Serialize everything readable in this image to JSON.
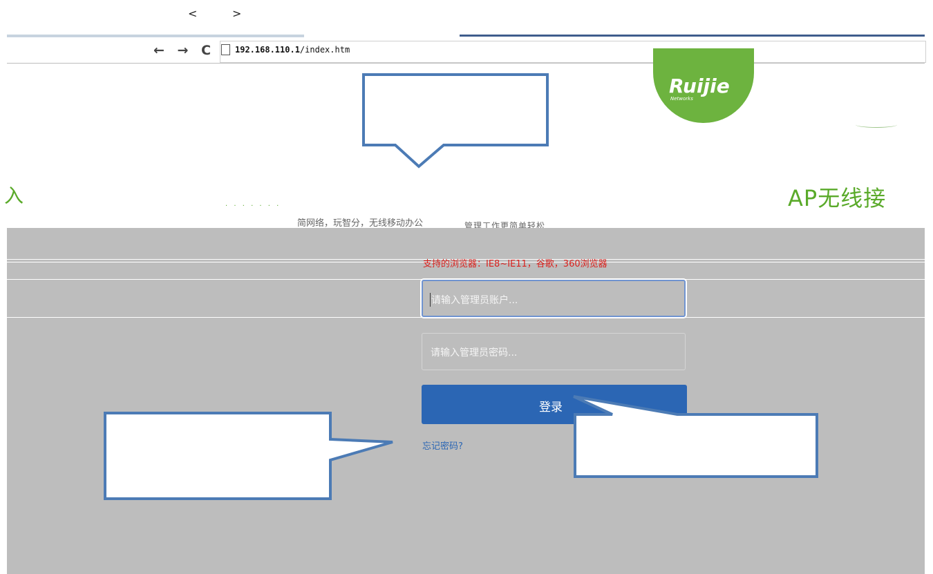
{
  "slideshow": {
    "prev_label": "<",
    "next_label": ">"
  },
  "browser": {
    "back_icon": "back-arrow-icon",
    "forward_icon": "forward-arrow-icon",
    "reload_icon": "reload-icon",
    "page_icon": "page-icon",
    "nav_glyphs": "← → C",
    "url_host": "192.168.110.1",
    "url_path": "/index.htm"
  },
  "brand": {
    "logo_text": "Ruijie",
    "logo_subtext": "Networks",
    "accent_color": "#6db33f"
  },
  "header": {
    "headline_left": "入",
    "headline_right": "AP无线接",
    "subtitle": "简网络，玩智分，无线移动办公",
    "subtitle_tail": "管理工作更简单轻松"
  },
  "login": {
    "supported_browsers": "支持的浏览器：IE8~IE11，谷歌，360浏览器",
    "username_placeholder": "请输入管理员账户...",
    "password_placeholder": "请输入管理员密码...",
    "login_button": "登录",
    "forgot_password": "忘记密码?",
    "button_color": "#2b66b4",
    "warning_color": "#d9201c"
  },
  "annotations": {
    "callout_color": "#4c7bb5"
  }
}
